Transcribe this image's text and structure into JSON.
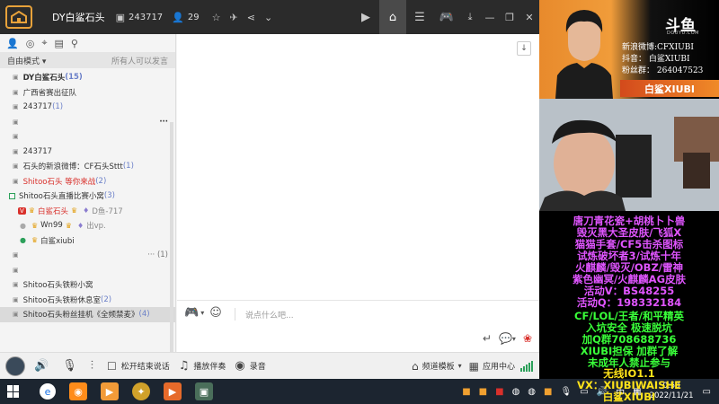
{
  "titlebar": {
    "channel_name": "DY白鲨石头",
    "channel_id": "243717",
    "viewers": "29"
  },
  "left": {
    "mode_label": "自由模式",
    "mode_right": "所有人可以发言",
    "rows": [
      {
        "name": "DY白鲨石头",
        "count": "(15)"
      },
      {
        "name": "广西省赛出征队",
        "count": ""
      },
      {
        "name": "243717",
        "count": "(1)"
      },
      {
        "name": "243717",
        "count": ""
      },
      {
        "name": "石头的新浪微博：CF石头Sttt",
        "count": "(1)"
      },
      {
        "name": "Shitoo石头  等你来战",
        "count": "(2)"
      },
      {
        "name": "Shitoo石头直播比赛小窝",
        "count": "(3)"
      },
      {
        "name": "Shitoo石头铁粉小窝",
        "count": ""
      },
      {
        "name": "Shitoo石头铁粉休息室",
        "count": "(2)"
      },
      {
        "name": "Shitoo石头粉丝挂机《全频禁麦》",
        "count": "(4)"
      }
    ],
    "members": [
      {
        "name": "白鲨石头",
        "extra": "D鱼-717"
      },
      {
        "name": "Wn99",
        "extra": "出vp."
      },
      {
        "name": "白鲨xiubi",
        "extra": ""
      }
    ],
    "ellipsis": "···",
    "sub_count": "(1)"
  },
  "input": {
    "placeholder": "说点什么吧..."
  },
  "bottombar": {
    "release_label": "松开结束说话",
    "music_label": "播放伴奏",
    "record_label": "录音",
    "template_label": "频道模板",
    "app_center_label": "应用中心"
  },
  "taskbar": {
    "ime": "中",
    "time": "0:58",
    "date": "2022/11/21"
  },
  "stream": {
    "platform": "斗鱼",
    "platform_sub": "DOUYU.COM",
    "weibo": "新浪微博:CFXIUBI",
    "douyin": "抖音：  白鲨XIUBI",
    "fans": "粉丝群：  264047523",
    "name_banner": "白鲨XIUBI",
    "ad_magenta": [
      "唐刀青花瓷+胡桃卜卜兽",
      "毁灭黑大圣皮肤/飞狐X",
      "猫猫手套/CF5击杀图标",
      "试炼破坏者3/试炼十年",
      "火麒麟/毁灭/OBZ/雷神",
      "紫色幽冥/火麒麟AG皮肤",
      "活动V：BS48255",
      "活动Q：198332184"
    ],
    "ad_green": [
      "CF/LOL/王者/和平精英",
      "入坑安全    极速脱坑",
      "加Q群708688736",
      "XIUBI担保    加群了解",
      "未成年人禁止参与"
    ],
    "ad_yellow": [
      "无线IO1.1",
      "VX：XIUBIWAISHE",
      "白鲨XIUBI"
    ]
  }
}
